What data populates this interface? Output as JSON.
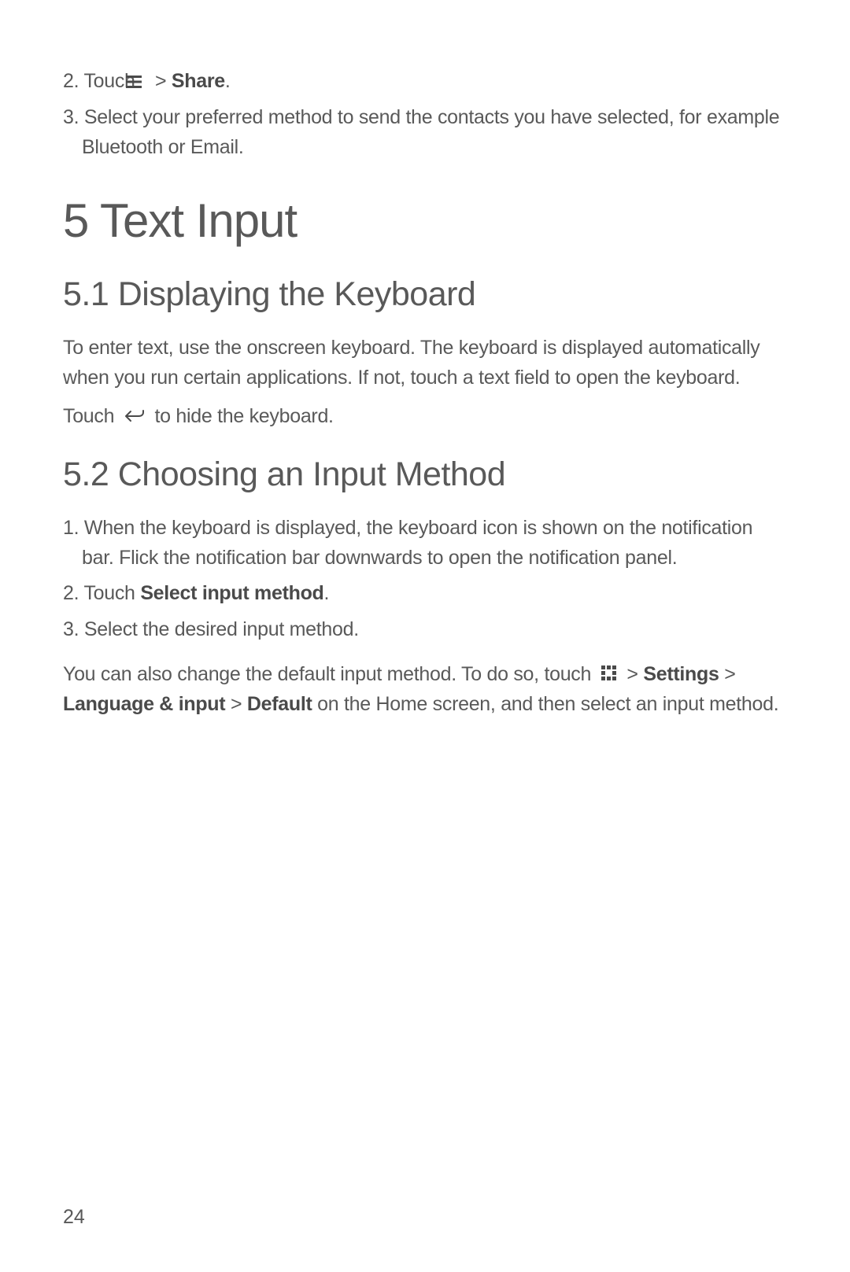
{
  "step2": {
    "prefix": "2. Touch ",
    "suffix": " > ",
    "bold": "Share",
    "end": "."
  },
  "step3": "3. Select your preferred method to send the contacts you have selected, for example Bluetooth or Email.",
  "h1": "5  Text Input",
  "section51": {
    "heading": "5.1  Displaying the Keyboard",
    "p1": "To enter text, use the onscreen keyboard. The keyboard is displayed automatically when you run certain applications. If not, touch a text field to open the keyboard.",
    "p2_prefix": "Touch ",
    "p2_suffix": " to hide the keyboard."
  },
  "section52": {
    "heading": "5.2  Choosing an Input Method",
    "step1": "1. When the keyboard is displayed, the keyboard icon is shown on the notification bar. Flick the notification bar downwards to open the notification panel.",
    "step2_prefix": "2. Touch ",
    "step2_bold": "Select input method",
    "step2_end": ".",
    "step3": "3. Select the desired input method.",
    "p_prefix": "You can also change the default input method. To do so, touch ",
    "p_gt1": " > ",
    "p_settings": "Settings",
    "p_gt2": " > ",
    "p_lang": "Language & input",
    "p_gt3": " > ",
    "p_default": "Default",
    "p_suffix": " on the Home screen, and then select an input method."
  },
  "pageNumber": "24"
}
